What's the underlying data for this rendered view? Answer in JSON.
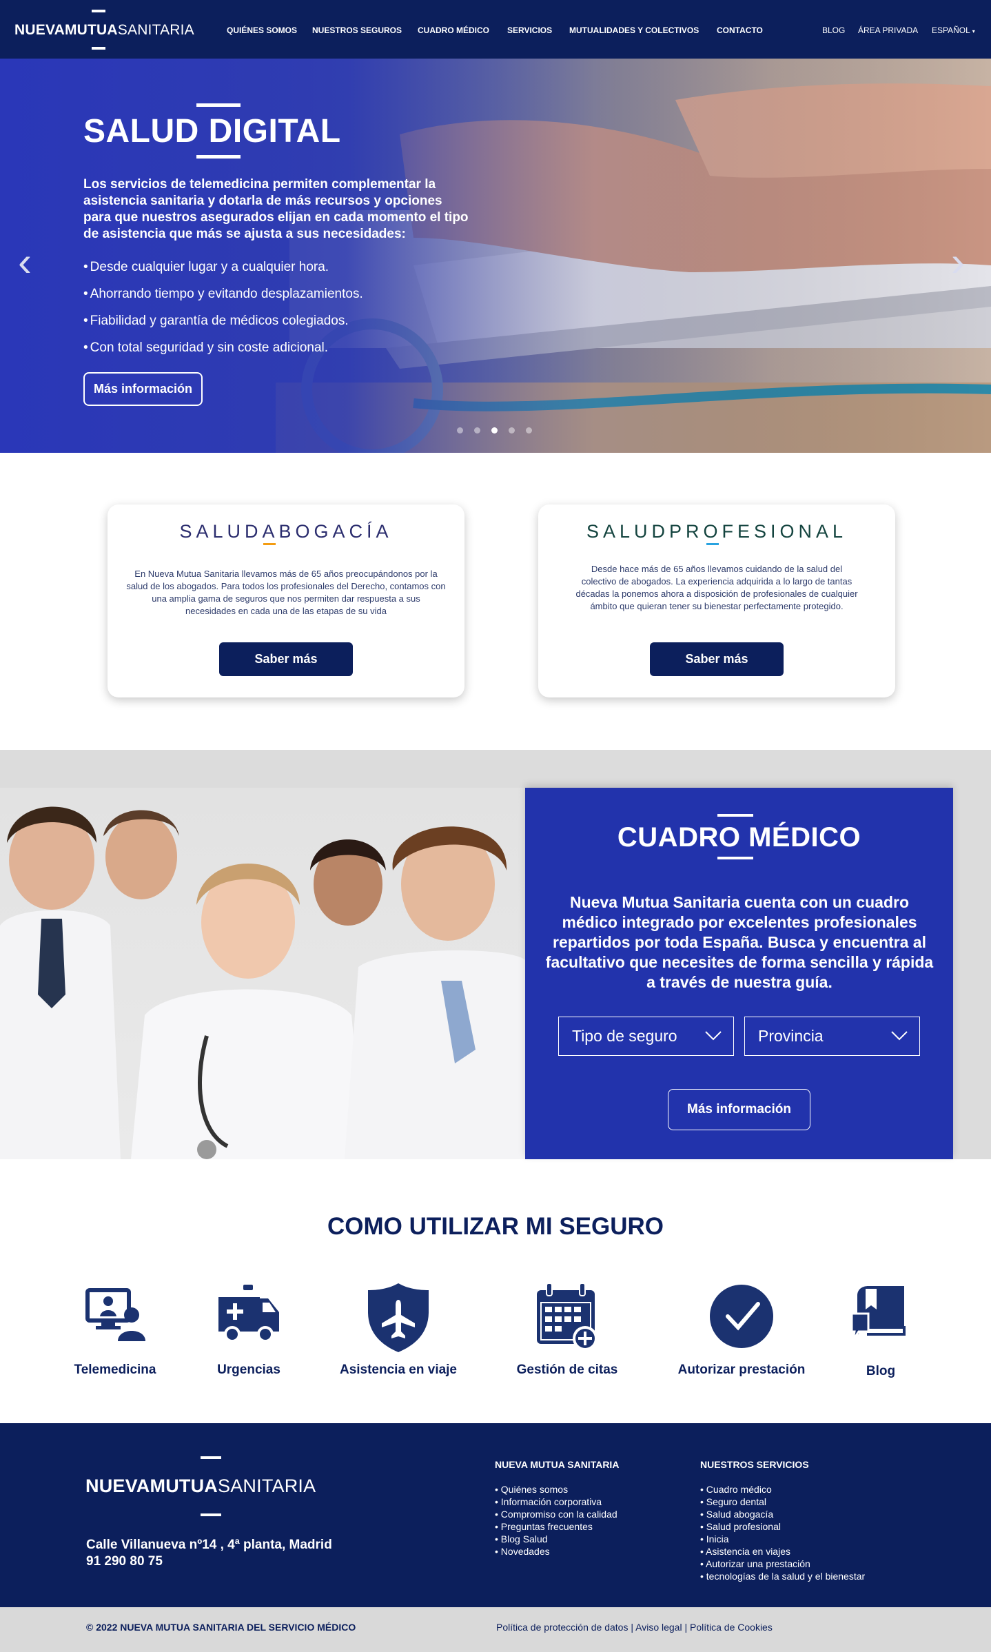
{
  "nav": {
    "logo_bold": "NUEVAMUTUA",
    "logo_thin": "SANITARIA",
    "items": [
      "QUIÉNES SOMOS",
      "NUESTROS SEGUROS",
      "CUADRO MÉDICO",
      "SERVICIOS",
      "MUTUALIDADES Y COLECTIVOS",
      "CONTACTO"
    ],
    "right": [
      "BLOG",
      "ÁREA PRIVADA",
      "ESPAÑOL"
    ]
  },
  "hero": {
    "title": "SALUD DIGITAL",
    "intro": "Los servicios de telemedicina permiten complementar la asistencia sanitaria y dotarla de más recursos y opciones para que nuestros asegurados elijan en cada momento el tipo de asistencia que más se ajusta a sus necesidades:",
    "bullets": [
      "Desde cualquier lugar y a cualquier hora.",
      "Ahorrando tiempo y evitando desplazamientos.",
      "Fiabilidad y garantía de médicos colegiados.",
      "Con total seguridad y sin coste adicional."
    ],
    "button": "Más información",
    "prev_arrow": "‹",
    "next_arrow": "›",
    "active_slide": 3,
    "slide_count": 5
  },
  "cards": [
    {
      "brand": "SALUDABOGACÍA",
      "text": "En Nueva Mutua Sanitaria llevamos más de 65 años preocupándonos por la salud de los abogados. Para todos los profesionales del Derecho, contamos con una amplia gama de seguros que nos permiten dar respuesta a sus necesidades en cada una de las etapas de su vida",
      "button": "Saber más",
      "brand_color": "#2b2d6e",
      "accent_color": "#f39c12"
    },
    {
      "brand": "SALUDPROFESIONAL",
      "text": "Desde hace más de 65 años llevamos cuidando de la salud del colectivo de abogados. La experiencia adquirida a lo largo de tantas décadas la ponemos ahora a disposición de profesionales de cualquier ámbito que quieran tener su bienestar perfectamente protegido.",
      "button": "Saber más",
      "brand_color": "#14443f",
      "accent_color": "#29a3e0"
    }
  ],
  "cuadro": {
    "title": "CUADRO MÉDICO",
    "text": "Nueva Mutua Sanitaria cuenta con un cuadro médico integrado por excelentes profesionales repartidos por toda España. Busca y encuentra al facultativo que necesites de forma sencilla y rápida a través de nuestra guía.",
    "select_tipo": "Tipo de seguro",
    "select_provincia": "Provincia",
    "button": "Más información"
  },
  "how": {
    "title": "COMO UTILIZAR MI SEGURO",
    "items": [
      {
        "label": "Telemedicina",
        "icon": "telemedicine-icon"
      },
      {
        "label": "Urgencias",
        "icon": "ambulance-icon"
      },
      {
        "label": "Asistencia en viaje",
        "icon": "plane-shield-icon"
      },
      {
        "label": "Gestión de citas",
        "icon": "calendar-plus-icon"
      },
      {
        "label": "Autorizar prestación",
        "icon": "check-circle-icon"
      },
      {
        "label": "Blog",
        "icon": "blog-book-icon"
      }
    ]
  },
  "footer": {
    "logo_bold": "NUEVAMUTUA",
    "logo_thin": "SANITARIA",
    "address": "Calle Villanueva nº14 , 4ª planta, Madrid",
    "phone": "91 290 80 75",
    "col1_title": "NUEVA MUTUA SANITARIA",
    "col1_items": [
      "Quiénes somos",
      "Información corporativa",
      "Compromiso con la calidad",
      "Preguntas frecuentes",
      "Blog Salud",
      "Novedades"
    ],
    "col2_title": "NUESTROS SERVICIOS",
    "col2_items": [
      "Cuadro médico",
      "Seguro dental",
      "Salud abogacía",
      "Salud profesional",
      "Inicia",
      "Asistencia en viajes",
      "Autorizar una prestación",
      "tecnologías de la salud y el bienestar"
    ],
    "copyright": "© 2022 NUEVA MUTUA SANITARIA DEL SERVICIO MÉDICO",
    "legal": [
      "Política de protección de datos",
      "Aviso legal",
      "Política de Cookies"
    ]
  },
  "colors": {
    "navy": "#0c1f5c",
    "royal_blue": "#2233ac",
    "grey": "#d9d9d9"
  }
}
